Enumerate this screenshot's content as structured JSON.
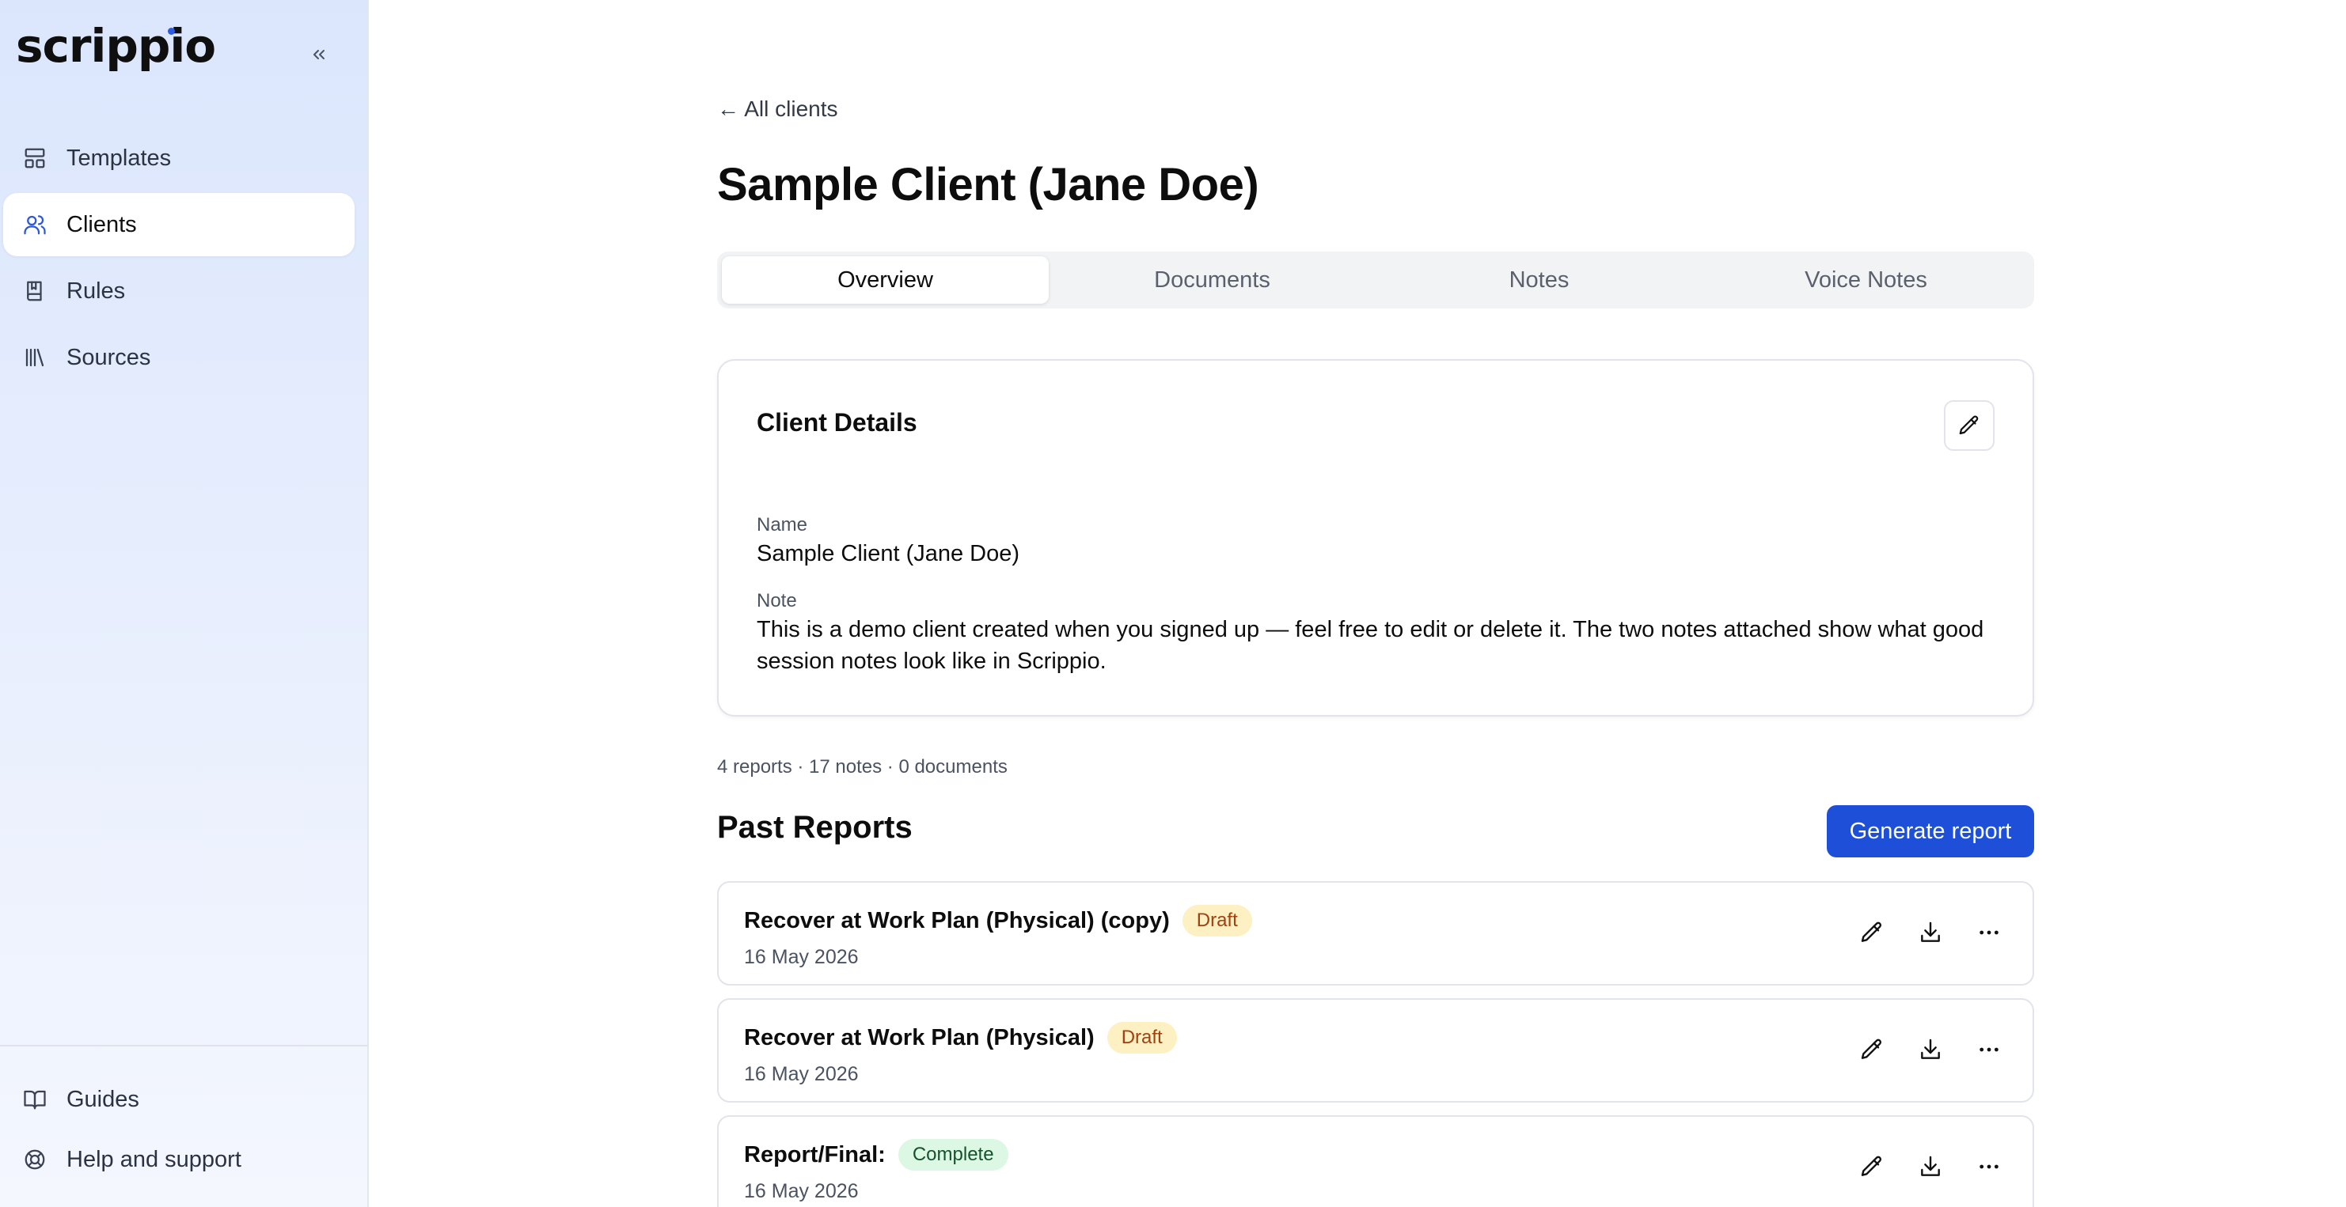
{
  "app": {
    "logo_text": "scrippio"
  },
  "sidebar": {
    "items": [
      {
        "label": "Templates",
        "icon": "layout-icon"
      },
      {
        "label": "Clients",
        "icon": "users-icon"
      },
      {
        "label": "Rules",
        "icon": "book-icon"
      },
      {
        "label": "Sources",
        "icon": "library-icon"
      }
    ],
    "footer": [
      {
        "label": "Guides",
        "icon": "open-book-icon"
      },
      {
        "label": "Help and support",
        "icon": "lifebuoy-icon"
      }
    ]
  },
  "header": {
    "back_label": "← All clients",
    "title": "Sample Client (Jane Doe)"
  },
  "tabs": [
    {
      "label": "Overview"
    },
    {
      "label": "Documents"
    },
    {
      "label": "Notes"
    },
    {
      "label": "Voice Notes"
    }
  ],
  "client_details": {
    "title": "Client Details",
    "name_label": "Name",
    "name_value": "Sample Client (Jane Doe)",
    "note_label": "Note",
    "note_value": "This is a demo client created when you signed up — feel free to edit or delete it. The two notes attached show what good session notes look like in Scrippio."
  },
  "summary": "4 reports · 17 notes · 0 documents",
  "past_reports": {
    "title": "Past Reports",
    "generate_label": "Generate report",
    "items": [
      {
        "title": "Recover at Work Plan (Physical) (copy)",
        "status": "Draft",
        "date": "16 May 2026"
      },
      {
        "title": "Recover at Work Plan (Physical)",
        "status": "Draft",
        "date": "16 May 2026"
      },
      {
        "title": "Report/Final:",
        "status": "Complete",
        "date": "16 May 2026"
      }
    ]
  },
  "colors": {
    "accent": "#1d4fd8",
    "draft_bg": "#fdf0c2",
    "draft_text": "#a2400f",
    "complete_bg": "#dcf7e3",
    "complete_text": "#14532d"
  }
}
